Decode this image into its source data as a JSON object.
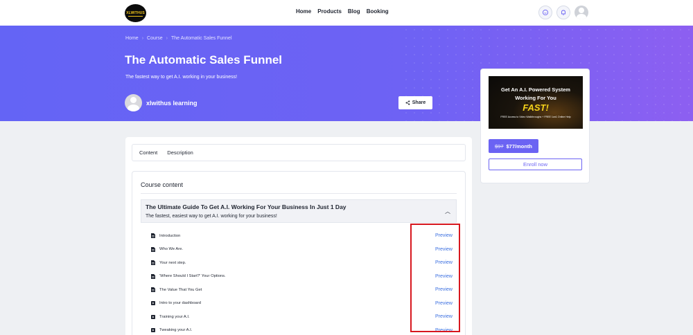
{
  "nav": {
    "logo_text": "XLWITHUS",
    "menu": [
      "Home",
      "Products",
      "Blog",
      "Booking"
    ],
    "icons": [
      "chat-icon",
      "bell-icon",
      "user-avatar-icon"
    ]
  },
  "hero": {
    "breadcrumb": [
      "Home",
      "Course",
      "The Automatic Sales Funnel"
    ],
    "title": "The Automatic Sales Funnel",
    "subtitle": "The fastest way to get A.I. working in your business!",
    "author": "xlwithus learning",
    "share_label": "Share"
  },
  "card": {
    "promo_line1": "Get An A.I. Powered System",
    "promo_line2": "Working For You",
    "promo_line3": "FAST!",
    "promo_line4": "FREE Access to Video Walkthroughs + FREE 1on1 Online Help",
    "old_price": "$97",
    "price": "$77/month",
    "enroll_label": "Enroll now"
  },
  "tabs": [
    "Content",
    "Description"
  ],
  "course": {
    "heading": "Course content",
    "section_title": "The Ultimate Guide To Get A.I. Working For Your Business In Just 1 Day",
    "section_subtitle": "The fastest, easiest way to get A.I. working for your business!",
    "lessons": [
      {
        "name": "Introduction",
        "type": "doc",
        "action": "Preview"
      },
      {
        "name": "Who We Are.",
        "type": "doc",
        "action": "Preview"
      },
      {
        "name": "Your next step.",
        "type": "doc",
        "action": "Preview"
      },
      {
        "name": "'Where Should I Start?' Your Options.",
        "type": "doc",
        "action": "Preview"
      },
      {
        "name": "The Value That You Get",
        "type": "doc",
        "action": "Preview"
      },
      {
        "name": "Intro to your dashboard",
        "type": "video",
        "action": "Preview"
      },
      {
        "name": "Training your A.I.",
        "type": "video",
        "action": "Preview"
      },
      {
        "name": "Tweaking your A.I.",
        "type": "video",
        "action": "Preview"
      }
    ]
  },
  "colors": {
    "accent": "#6b63f3",
    "link": "#3b6fe0",
    "highlight": "#d7171e"
  }
}
